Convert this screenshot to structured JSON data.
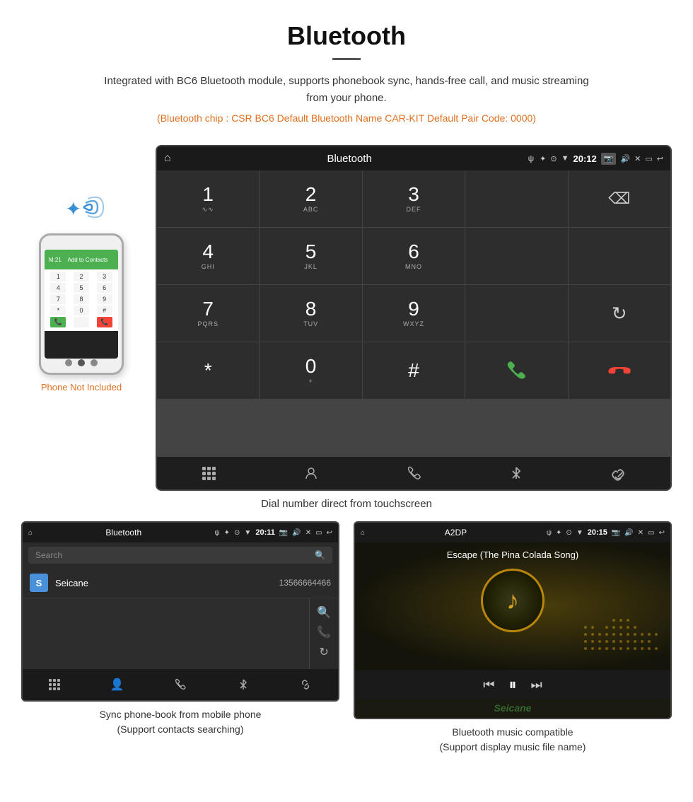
{
  "header": {
    "title": "Bluetooth",
    "description": "Integrated with BC6 Bluetooth module, supports phonebook sync, hands-free call, and music streaming from your phone.",
    "specs": "(Bluetooth chip : CSR BC6   Default Bluetooth Name CAR-KIT   Default Pair Code: 0000)"
  },
  "phone_note": "Phone Not Included",
  "dialpad_screen": {
    "statusbar": {
      "home_icon": "⌂",
      "title": "Bluetooth",
      "usb_icon": "ψ",
      "time": "20:12",
      "icons_right": "✦ ⚙ ▼ ✕ ▭ ↩"
    },
    "keys": [
      {
        "num": "1",
        "sub": "∿∿"
      },
      {
        "num": "2",
        "sub": "ABC"
      },
      {
        "num": "3",
        "sub": "DEF"
      },
      {
        "num": "",
        "sub": ""
      },
      {
        "num": "⌫",
        "sub": ""
      },
      {
        "num": "4",
        "sub": "GHI"
      },
      {
        "num": "5",
        "sub": "JKL"
      },
      {
        "num": "6",
        "sub": "MNO"
      },
      {
        "num": "",
        "sub": ""
      },
      {
        "num": "",
        "sub": ""
      },
      {
        "num": "7",
        "sub": "PQRS"
      },
      {
        "num": "8",
        "sub": "TUV"
      },
      {
        "num": "9",
        "sub": "WXYZ"
      },
      {
        "num": "",
        "sub": ""
      },
      {
        "num": "↻",
        "sub": ""
      },
      {
        "num": "*",
        "sub": ""
      },
      {
        "num": "0",
        "sub": "+"
      },
      {
        "num": "#",
        "sub": ""
      },
      {
        "num": "📞",
        "sub": ""
      },
      {
        "num": "📞",
        "sub": ""
      }
    ],
    "bottom_icons": [
      "⊞",
      "👤",
      "📞",
      "✱",
      "🔗"
    ]
  },
  "dialpad_caption": "Dial number direct from touchscreen",
  "phonebook_screen": {
    "statusbar_title": "Bluetooth",
    "usb_icon": "ψ",
    "time": "20:11",
    "search_placeholder": "Search",
    "contact": {
      "initial": "S",
      "name": "Seicane",
      "number": "13566664466"
    },
    "bottom_icons": [
      "⊞",
      "👤",
      "📞",
      "✱",
      "🔗"
    ]
  },
  "phonebook_caption_line1": "Sync phone-book from mobile phone",
  "phonebook_caption_line2": "(Support contacts searching)",
  "music_screen": {
    "statusbar_title": "A2DP",
    "time": "20:15",
    "song_title": "Escape (The Pina Colada Song)",
    "note_icon": "♪"
  },
  "music_caption_line1": "Bluetooth music compatible",
  "music_caption_line2": "(Support display music file name)",
  "seicane_watermark": "Seicane"
}
